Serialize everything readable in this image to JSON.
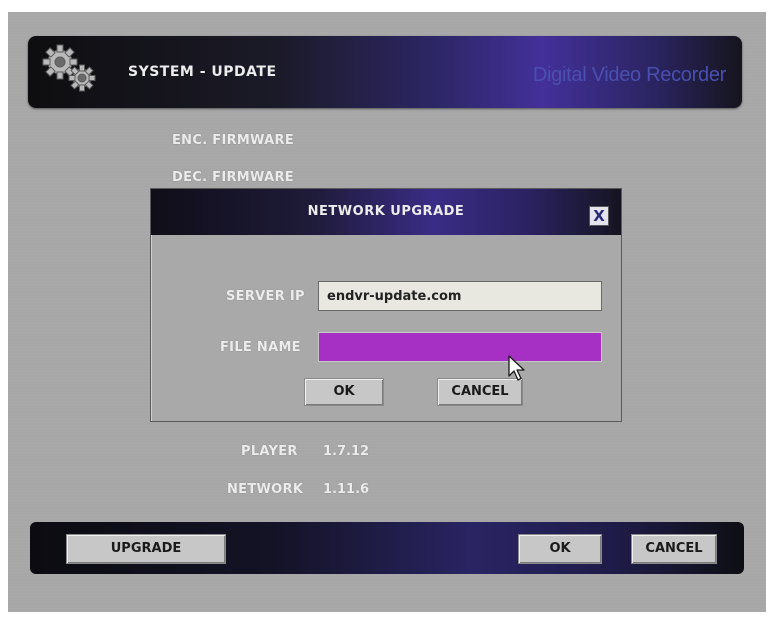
{
  "header": {
    "title": "SYSTEM - UPDATE",
    "brand": "Digital Video Recorder",
    "icon": "gear-icon"
  },
  "firmware": {
    "enc_label": "ENC. FIRMWARE",
    "dec_label": "DEC. FIRMWARE"
  },
  "dialog": {
    "title": "NETWORK UPGRADE",
    "close_label": "X",
    "server_ip_label": "SERVER IP",
    "server_ip_value": "endvr-update.com",
    "file_name_label": "FILE NAME",
    "file_name_value": "",
    "ok_label": "OK",
    "cancel_label": "CANCEL"
  },
  "versions": {
    "player_label": "PLAYER",
    "player_value": "1.7.12",
    "network_label": "NETWORK",
    "network_value": "1.11.6"
  },
  "footer": {
    "upgrade_label": "UPGRADE",
    "ok_label": "OK",
    "cancel_label": "CANCEL"
  },
  "colors": {
    "background": "#a7a7a7",
    "file_field": "#a630c4",
    "brand_text": "#4a4fb0"
  }
}
